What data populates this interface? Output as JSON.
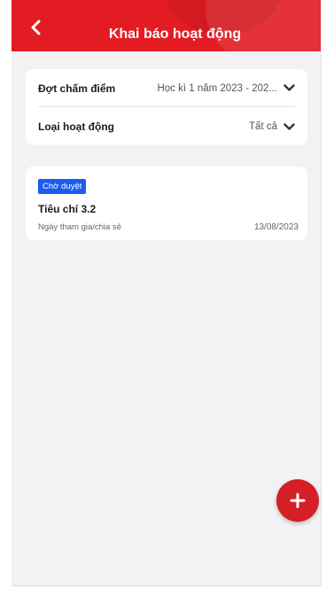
{
  "header": {
    "title": "Khai báo hoạt động",
    "back_icon": "chevron-left-icon",
    "color": "#e31b23"
  },
  "filters": {
    "period": {
      "label": "Đợt chấm điểm",
      "value": "Học kì 1 năm 2023 - 202..."
    },
    "activity_type": {
      "label": "Loại hoạt động",
      "value": "Tất cả"
    }
  },
  "activities": [
    {
      "status": "Chờ duyệt",
      "status_color": "#1a5bf0",
      "title": "Tiêu chí 3.2",
      "subtitle": "Ngày tham gia/chia sẻ",
      "date": "13/08/2023"
    }
  ],
  "fab": {
    "icon": "plus-icon",
    "color": "#d51f26"
  }
}
